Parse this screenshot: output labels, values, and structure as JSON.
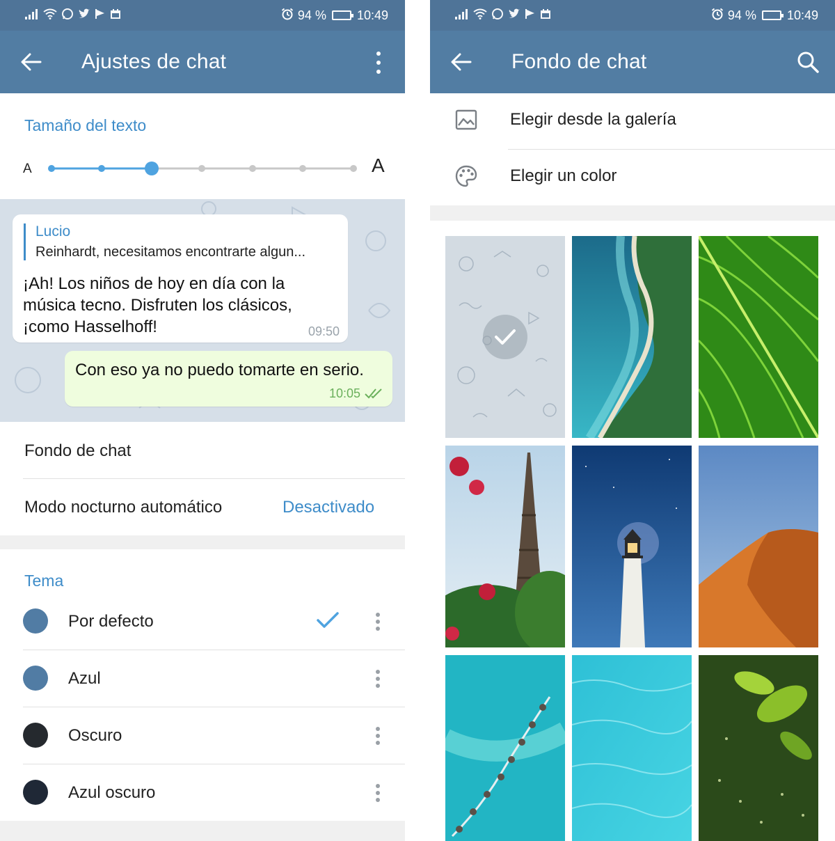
{
  "colors": {
    "statusbar": "#4f7498",
    "appbar": "#527da3",
    "accent": "#3e8cc9",
    "outgoing_bubble": "#effdde",
    "chat_bg": "#d6dfe8"
  },
  "left": {
    "status": {
      "battery": "94 %",
      "time": "10:49"
    },
    "appbar": {
      "title": "Ajustes de chat",
      "back_icon": "arrow-left-icon",
      "menu_icon": "more-vert-icon"
    },
    "text_size": {
      "title": "Tamaño del texto",
      "small_label": "A",
      "large_label": "A",
      "steps": 7,
      "selected_step": 3
    },
    "preview": {
      "incoming": {
        "reply_name": "Lucio",
        "reply_text": "Reinhardt, necesitamos encontrarte algun...",
        "line1": "¡Ah! Los niños de hoy en día con la",
        "line2": "música tecno. Disfruten los clásicos,",
        "line3": "¡como Hasselhoff!",
        "time": "09:50"
      },
      "outgoing": {
        "text": "Con eso ya no puedo tomarte en serio.",
        "time": "10:05"
      }
    },
    "settings": {
      "chat_background": "Fondo de chat",
      "night_mode_label": "Modo nocturno automático",
      "night_mode_value": "Desactivado"
    },
    "themes": {
      "title": "Tema",
      "items": [
        {
          "label": "Por defecto",
          "color": "#517ca4",
          "selected": true
        },
        {
          "label": "Azul",
          "color": "#517ca4",
          "selected": false
        },
        {
          "label": "Oscuro",
          "color": "#25292e",
          "selected": false
        },
        {
          "label": "Azul oscuro",
          "color": "#1f2836",
          "selected": false
        }
      ]
    }
  },
  "right": {
    "status": {
      "battery": "94 %",
      "time": "10:49"
    },
    "appbar": {
      "title": "Fondo de chat",
      "back_icon": "arrow-left-icon",
      "search_icon": "search-icon"
    },
    "options": [
      {
        "label": "Elegir desde la galería",
        "icon": "image-icon"
      },
      {
        "label": "Elegir un color",
        "icon": "palette-icon"
      }
    ],
    "wallpapers": [
      {
        "name": "default-pattern",
        "selected": true
      },
      {
        "name": "aerial-coast"
      },
      {
        "name": "green-leaf"
      },
      {
        "name": "eiffel-tower"
      },
      {
        "name": "lighthouse"
      },
      {
        "name": "desert-dune"
      },
      {
        "name": "overwater-villas"
      },
      {
        "name": "turquoise-water"
      },
      {
        "name": "green-bokeh"
      }
    ]
  }
}
